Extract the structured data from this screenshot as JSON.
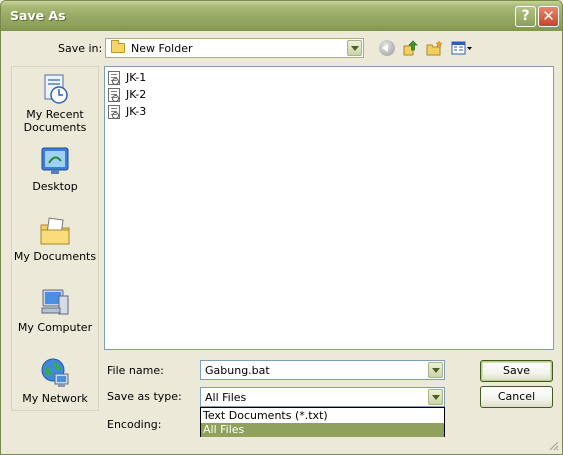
{
  "window": {
    "title": "Save As",
    "help_glyph": "?",
    "close_glyph": "✕"
  },
  "toolbar": {
    "save_in_label": "Save in:",
    "save_in_value": "New Folder",
    "icons": [
      "back-icon",
      "up-folder-icon",
      "new-folder-icon",
      "views-menu-icon"
    ]
  },
  "places": [
    {
      "label_1": "My Recent",
      "label_2": "Documents",
      "icon": "recent-documents-icon"
    },
    {
      "label_1": "Desktop",
      "label_2": "",
      "icon": "desktop-icon"
    },
    {
      "label_1": "My Documents",
      "label_2": "",
      "icon": "my-documents-icon"
    },
    {
      "label_1": "My Computer",
      "label_2": "",
      "icon": "my-computer-icon"
    },
    {
      "label_1": "My Network",
      "label_2": "",
      "icon": "my-network-icon"
    }
  ],
  "files": [
    {
      "name": "JK-1"
    },
    {
      "name": "JK-2"
    },
    {
      "name": "JK-3"
    }
  ],
  "form": {
    "file_name_label": "File name:",
    "file_name_value": "Gabung.bat",
    "save_as_type_label": "Save as type:",
    "save_as_type_value": "All Files",
    "encoding_label": "Encoding:",
    "type_options": [
      {
        "label": "Text Documents (*.txt)",
        "selected": false
      },
      {
        "label": "All Files",
        "selected": true
      }
    ]
  },
  "buttons": {
    "save": "Save",
    "cancel": "Cancel"
  },
  "colors": {
    "accent": "#8ea25c",
    "title_bar": "#98ab66",
    "close_button": "#c4462c"
  }
}
